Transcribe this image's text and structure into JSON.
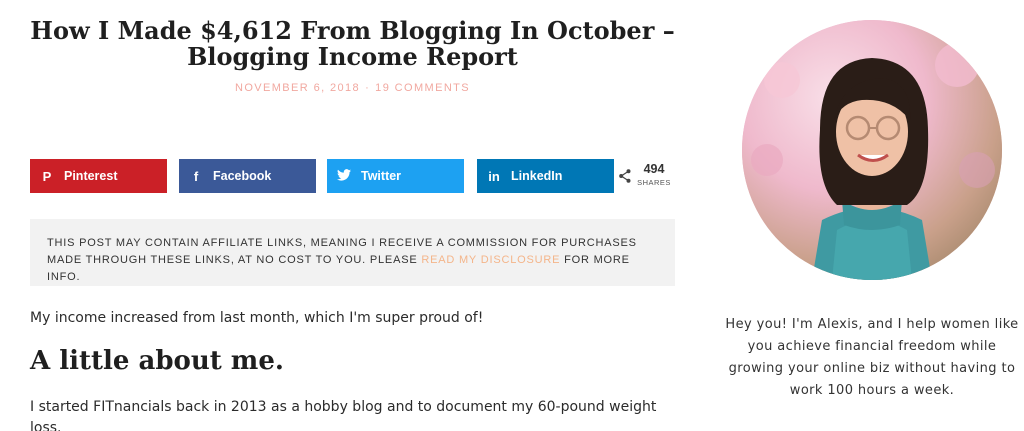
{
  "post": {
    "title": "How I Made $4,612 From Blogging In October – Blogging Income Report",
    "date": "NOVEMBER 6, 2018",
    "separator": "·",
    "comments": "19 COMMENTS"
  },
  "share": {
    "buttons": [
      {
        "label": "Pinterest",
        "icon": "pinterest-icon",
        "glyph": "P",
        "color": "#cb2027"
      },
      {
        "label": "Facebook",
        "icon": "facebook-icon",
        "glyph": "f",
        "color": "#3b5998"
      },
      {
        "label": "Twitter",
        "icon": "twitter-icon",
        "glyph": "t",
        "color": "#1da1f2"
      },
      {
        "label": "LinkedIn",
        "icon": "linkedin-icon",
        "glyph": "in",
        "color": "#0077b5"
      }
    ],
    "count": "494",
    "count_label": "SHARES"
  },
  "disclosure": {
    "text_before": "This post may contain affiliate links, meaning I receive a commission for purchases made through these links, at no cost to you. Please ",
    "link_text": "read my disclosure",
    "text_after": " for more info."
  },
  "content": {
    "intro": "My income increased from last month, which I'm super proud of!",
    "heading": "A little about me.",
    "paragraph": "I started FITnancials back in 2013 as a hobby blog and to document my 60-pound weight loss."
  },
  "sidebar": {
    "bio": "Hey you! I'm Alexis, and I help women like you achieve financial freedom while growing your online biz without having to work 100 hours a week."
  }
}
